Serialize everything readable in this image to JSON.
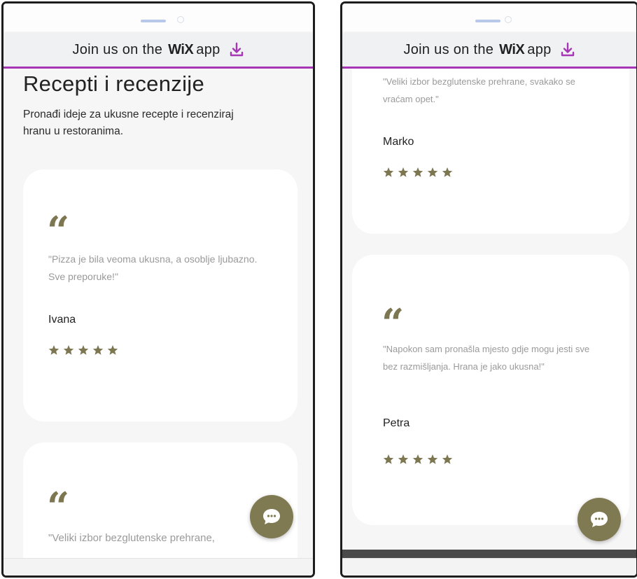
{
  "banner": {
    "prefix": "Join us on the",
    "brand": "WiX",
    "suffix": "app"
  },
  "page": {
    "title": "Recepti i recenzije",
    "subtitle": "Pronađi ideje za ukusne recepte i recenziraj hranu u restoranima."
  },
  "reviews_left": [
    {
      "quote_mark": "“",
      "text": "\"Pizza je bila veoma ukusna, a osoblje ljubazno. Sve preporuke!\"",
      "author": "Ivana",
      "rating": 5
    },
    {
      "quote_mark": "“",
      "text": "\"Veliki izbor bezglutenske prehrane,"
    }
  ],
  "reviews_right": [
    {
      "text": "\"Veliki izbor bezglutenske prehrane, svakako se vraćam opet.\"",
      "author": "Marko",
      "rating": 5
    },
    {
      "quote_mark": "“",
      "text": "\"Napokon sam pronašla mjesto gdje mogu jesti sve bez razmišljanja. Hrana je jako ukusna!\"",
      "author": "Petra",
      "rating": 5
    }
  ],
  "colors": {
    "accent": "#7c7651",
    "banner_line": "#a636b5",
    "download_icon": "#a636b5"
  },
  "icons": {
    "download": "download-icon",
    "star": "star-icon",
    "chat": "chat-icon"
  }
}
